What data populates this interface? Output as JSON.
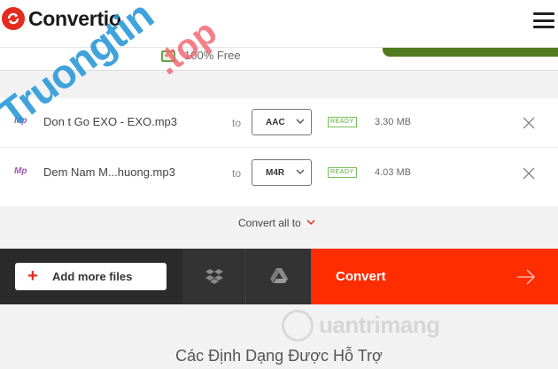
{
  "header": {
    "brand": "Convertio",
    "menu_icon": "hamburger-menu-icon"
  },
  "banner": {
    "free_label": "100% Free"
  },
  "files": [
    {
      "icon_label": "Mp",
      "name": "Don t Go EXO - EXO.mp3",
      "to_label": "to",
      "format": "AAC",
      "status": "READY",
      "size": "3.30 MB"
    },
    {
      "icon_label": "Mp",
      "name": "Dem Nam M...huong.mp3",
      "to_label": "to",
      "format": "M4R",
      "status": "READY",
      "size": "4.03 MB"
    }
  ],
  "convert_all": {
    "label": "Convert all to"
  },
  "actions": {
    "add_files_label": "Add more files",
    "convert_label": "Convert"
  },
  "footer": {
    "watermark": "uantrimang",
    "section_title": "Các Định Dạng Được Hỗ Trợ"
  },
  "overlay": {
    "watermark_main": "Truongtin",
    "watermark_suffix": ".top"
  },
  "colors": {
    "brand_red": "#e32b1f",
    "convert_bg": "#ff2d00",
    "action_bar_bg": "#2b2b2b",
    "ready_green": "#5aa83a"
  }
}
